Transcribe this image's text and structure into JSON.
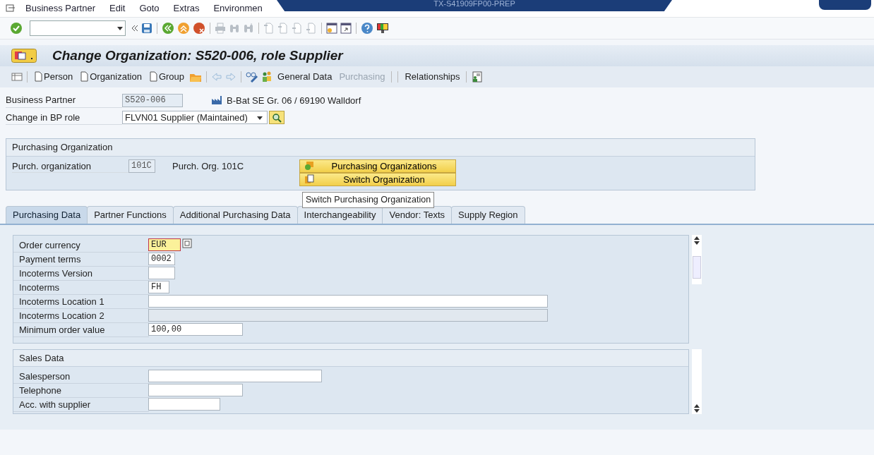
{
  "menu": [
    {
      "label": "Business Partner"
    },
    {
      "label": "Edit"
    },
    {
      "label": "Goto"
    },
    {
      "label": "Extras"
    },
    {
      "label": "Environmen"
    }
  ],
  "remote_bar": {
    "title": "TX-S41909FP00-PREP"
  },
  "title": "Change Organization: S520-006, role Supplier",
  "app_toolbar": [
    {
      "kind": "create",
      "label": "Person",
      "disabled": false
    },
    {
      "kind": "create",
      "label": "Organization",
      "disabled": false
    },
    {
      "kind": "create",
      "label": "Group",
      "disabled": false
    },
    {
      "kind": "text",
      "label": "General Data",
      "disabled": false
    },
    {
      "kind": "text",
      "label": "Purchasing",
      "disabled": true
    },
    {
      "kind": "text",
      "label": "Relationships",
      "disabled": false
    }
  ],
  "header_fields": [
    {
      "label": "Business Partner",
      "value": "S520-006",
      "description": "B-Bat SE Gr. 06 / 69190 Walldorf"
    },
    {
      "label": "Change in BP role",
      "value": "FLVN01 Supplier (Maintained)"
    }
  ],
  "purchasing_org": {
    "title": "Purchasing Organization",
    "label": "Purch. organization",
    "value": "101C",
    "description": "Purch. Org. 101C",
    "buttons": [
      {
        "label": "Purchasing Organizations"
      },
      {
        "label": "Switch Organization"
      }
    ],
    "tooltip": "Switch Purchasing Organization"
  },
  "tabs": [
    {
      "label": "Purchasing Data",
      "selected": true
    },
    {
      "label": "Partner Functions",
      "selected": false
    },
    {
      "label": "Additional Purchasing Data",
      "selected": false
    },
    {
      "label": "Interchangeability",
      "selected": false
    },
    {
      "label": "Vendor: Texts",
      "selected": false
    },
    {
      "label": "Supply Region",
      "selected": false
    }
  ],
  "purchasing_fields": [
    {
      "label": "Order currency",
      "value": "EUR",
      "focused": true,
      "disabled": false
    },
    {
      "label": "Payment terms",
      "value": "0002",
      "focused": false,
      "disabled": false
    },
    {
      "label": "Incoterms Version",
      "focused": false,
      "disabled": false
    },
    {
      "label": "Incoterms",
      "value": "FH",
      "focused": false,
      "disabled": false
    },
    {
      "label": "Incoterms Location 1",
      "focused": false,
      "disabled": false
    },
    {
      "label": "Incoterms Location 2",
      "focused": false,
      "disabled": true
    },
    {
      "label": "Minimum order value",
      "value": "100,00",
      "focused": false,
      "disabled": false
    }
  ],
  "sales_data": {
    "title": "Sales Data",
    "fields": [
      {
        "label": "Salesperson"
      },
      {
        "label": "Telephone"
      },
      {
        "label": "Acc. with supplier"
      }
    ]
  }
}
